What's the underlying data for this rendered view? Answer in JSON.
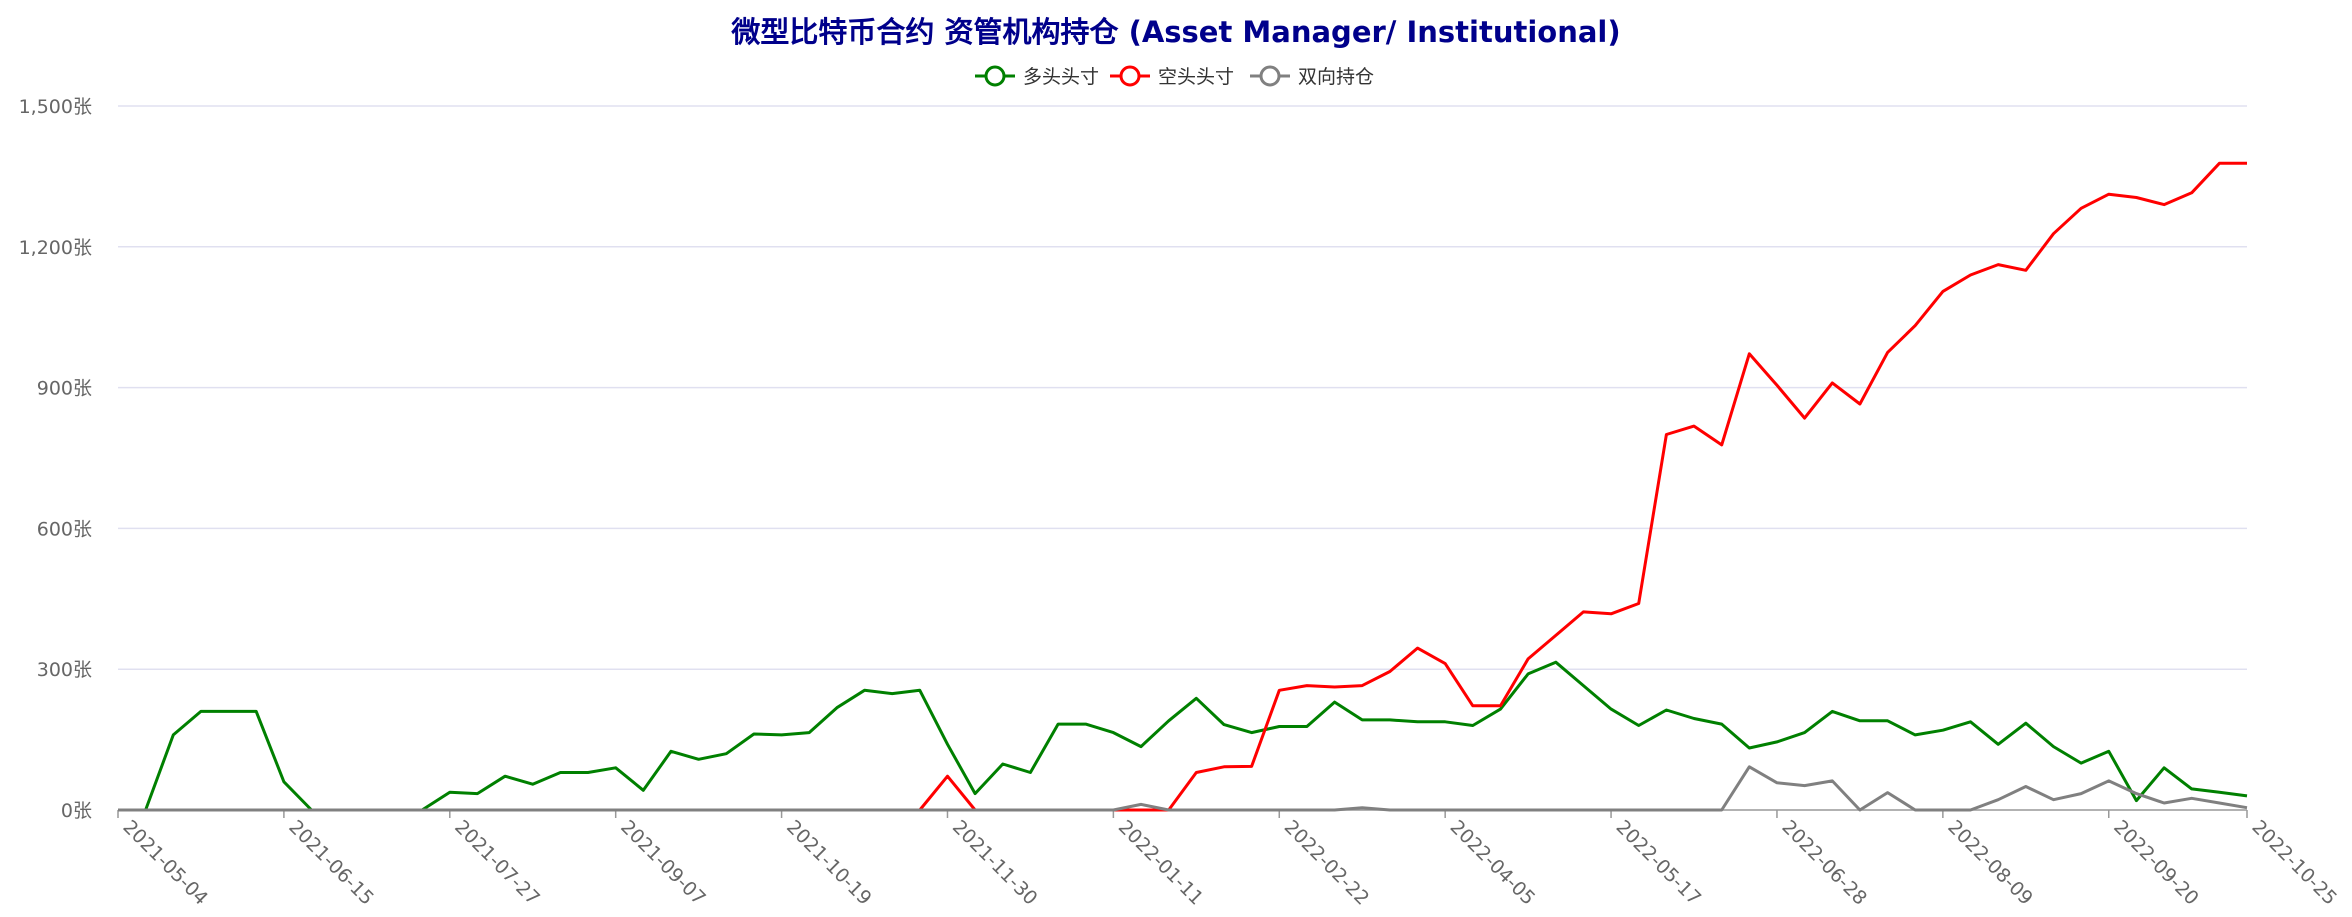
{
  "colors": {
    "title": "#00008b",
    "long": "#008000",
    "short": "#ff0000",
    "spread": "#808080",
    "grid": "#e0e0f0",
    "axis": "#999999",
    "tick_text": "#666666",
    "legend_text": "#333333"
  },
  "chart_data": {
    "type": "line",
    "title": "微型比特币合约 资管机构持仓 (Asset Manager/ Institutional)",
    "xlabel": "",
    "ylabel": "",
    "ylim": [
      0,
      1500
    ],
    "y_ticks": [
      0,
      300,
      600,
      900,
      1200,
      1500
    ],
    "y_tick_labels": [
      "0张",
      "300张",
      "600张",
      "900张",
      "1,200张",
      "1,500张"
    ],
    "x_tick_labels": [
      "2021-05-04",
      "2021-06-15",
      "2021-07-27",
      "2021-09-07",
      "2021-10-19",
      "2021-11-30",
      "2022-01-11",
      "2022-02-22",
      "2022-04-05",
      "2022-05-17",
      "2022-06-28",
      "2022-08-09",
      "2022-09-20",
      "2022-10-25"
    ],
    "x_tick_indices": [
      0,
      6,
      12,
      18,
      24,
      30,
      36,
      42,
      48,
      54,
      60,
      66,
      72,
      77
    ],
    "grid": true,
    "legend_position": "top-center",
    "series": [
      {
        "name": "多头头寸",
        "color": "#008000",
        "values": [
          0,
          0,
          160,
          210,
          210,
          210,
          60,
          0,
          0,
          0,
          0,
          0,
          38,
          35,
          72,
          55,
          80,
          80,
          90,
          42,
          125,
          108,
          120,
          162,
          160,
          165,
          218,
          255,
          248,
          255,
          140,
          35,
          98,
          80,
          183,
          183,
          165,
          135,
          190,
          238,
          182,
          165,
          178,
          178,
          230,
          192,
          192,
          188,
          188,
          180,
          215,
          290,
          315,
          265,
          215,
          180,
          213,
          195,
          183,
          132,
          145,
          165,
          210,
          190,
          190,
          160,
          170,
          188,
          140,
          185,
          135,
          100,
          125,
          20,
          90,
          45,
          38,
          30
        ]
      },
      {
        "name": "空头头寸",
        "color": "#ff0000",
        "values": [
          0,
          0,
          0,
          0,
          0,
          0,
          0,
          0,
          0,
          0,
          0,
          0,
          0,
          0,
          0,
          0,
          0,
          0,
          0,
          0,
          0,
          0,
          0,
          0,
          0,
          0,
          0,
          0,
          0,
          0,
          72,
          0,
          0,
          0,
          0,
          0,
          0,
          0,
          0,
          80,
          92,
          93,
          255,
          265,
          262,
          265,
          295,
          345,
          312,
          222,
          222,
          322,
          372,
          422,
          418,
          440,
          800,
          818,
          778,
          972,
          905,
          835,
          910,
          865,
          975,
          1032,
          1105,
          1140,
          1162,
          1150,
          1228,
          1282,
          1312,
          1305,
          1290,
          1315,
          1378,
          1378
        ]
      },
      {
        "name": "双向持仓",
        "color": "#808080",
        "values": [
          0,
          0,
          0,
          0,
          0,
          0,
          0,
          0,
          0,
          0,
          0,
          0,
          0,
          0,
          0,
          0,
          0,
          0,
          0,
          0,
          0,
          0,
          0,
          0,
          0,
          0,
          0,
          0,
          0,
          0,
          0,
          0,
          0,
          0,
          0,
          0,
          0,
          12,
          0,
          0,
          0,
          0,
          0,
          0,
          0,
          5,
          0,
          0,
          0,
          0,
          0,
          0,
          0,
          0,
          0,
          0,
          0,
          0,
          0,
          92,
          58,
          52,
          62,
          0,
          37,
          0,
          0,
          0,
          22,
          50,
          22,
          35,
          62,
          35,
          15,
          25,
          15,
          5
        ]
      }
    ]
  }
}
